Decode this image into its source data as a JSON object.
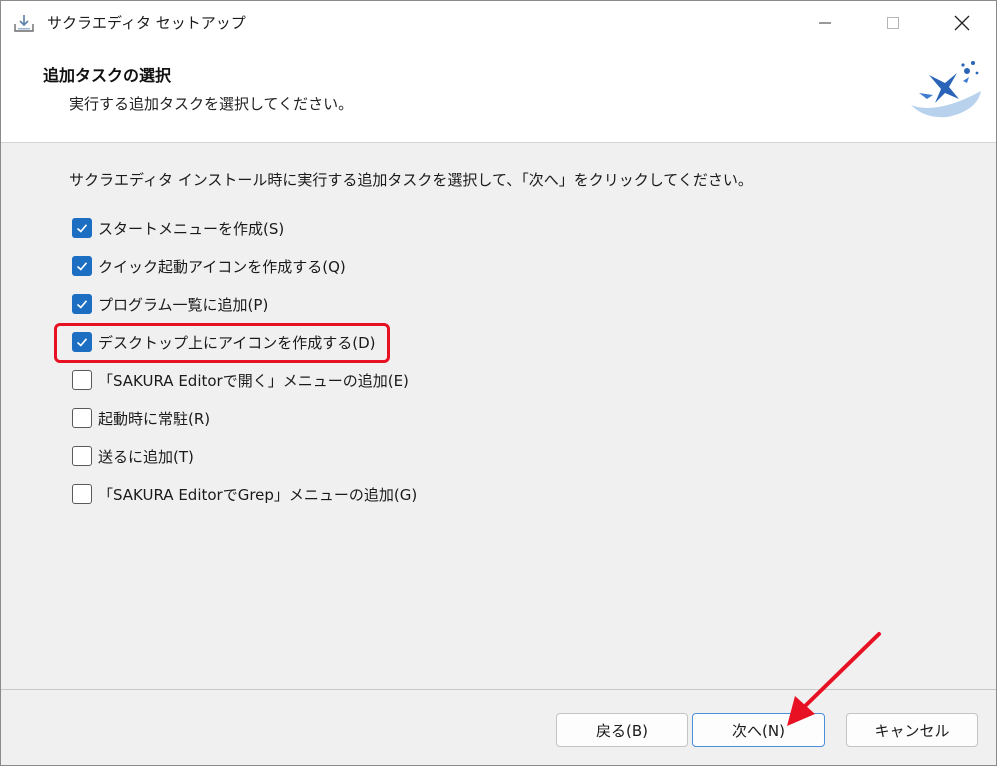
{
  "window": {
    "title": "サクラエディタ セットアップ"
  },
  "header": {
    "title": "追加タスクの選択",
    "subtitle": "実行する追加タスクを選択してください。"
  },
  "instruction": "サクラエディタ インストール時に実行する追加タスクを選択して、「次へ」をクリックしてください。",
  "tasks": [
    {
      "label": "スタートメニューを作成(S)",
      "checked": true
    },
    {
      "label": "クイック起動アイコンを作成する(Q)",
      "checked": true
    },
    {
      "label": "プログラム一覧に追加(P)",
      "checked": true
    },
    {
      "label": "デスクトップ上にアイコンを作成する(D)",
      "checked": true
    },
    {
      "label": "「SAKURA Editorで開く」メニューの追加(E)",
      "checked": false
    },
    {
      "label": "起動時に常駐(R)",
      "checked": false
    },
    {
      "label": "送るに追加(T)",
      "checked": false
    },
    {
      "label": "「SAKURA EditorでGrep」メニューの追加(G)",
      "checked": false
    }
  ],
  "buttons": {
    "back": "戻る(B)",
    "next": "次へ(N)",
    "cancel": "キャンセル"
  },
  "colors": {
    "accent": "#1b6ec2",
    "highlight": "#e81123"
  },
  "icons": [
    "installer-icon",
    "minimize-icon",
    "maximize-icon",
    "close-icon",
    "sakura-logo",
    "checkmark-icon",
    "annotation-arrow"
  ]
}
